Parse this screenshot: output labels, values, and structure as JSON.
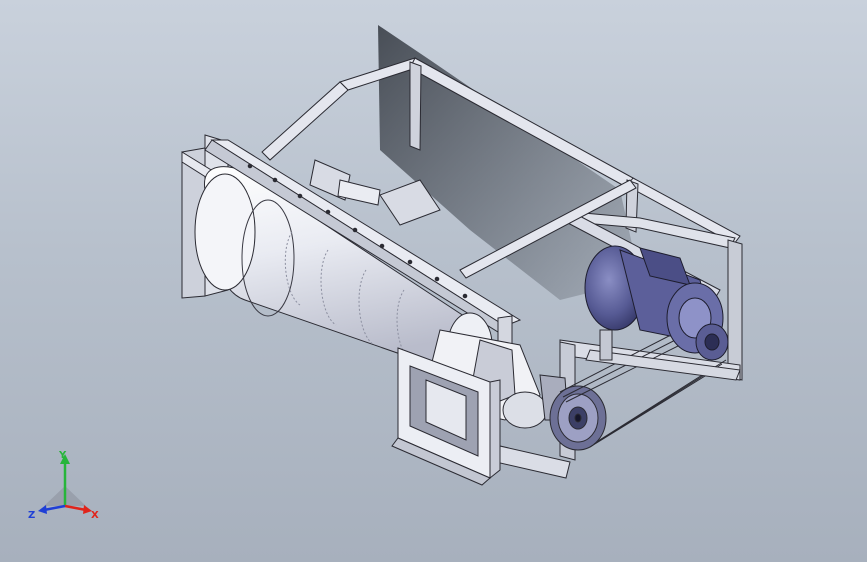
{
  "triad": {
    "x_label": "X",
    "y_label": "Y",
    "z_label": "Z",
    "x_color": "#e0241b",
    "y_color": "#27b53a",
    "z_color": "#1f3fd6"
  },
  "colors": {
    "background_top": "#c9d1dc",
    "background_bottom": "#a7b0bd",
    "frame": "#e4e6ee",
    "frame_edge": "#2b2b33",
    "drum": "#eceef4",
    "motor": "#5c5f9a",
    "shadow": "#2a2f37"
  },
  "icons": [
    "coordinate-triad-icon"
  ]
}
